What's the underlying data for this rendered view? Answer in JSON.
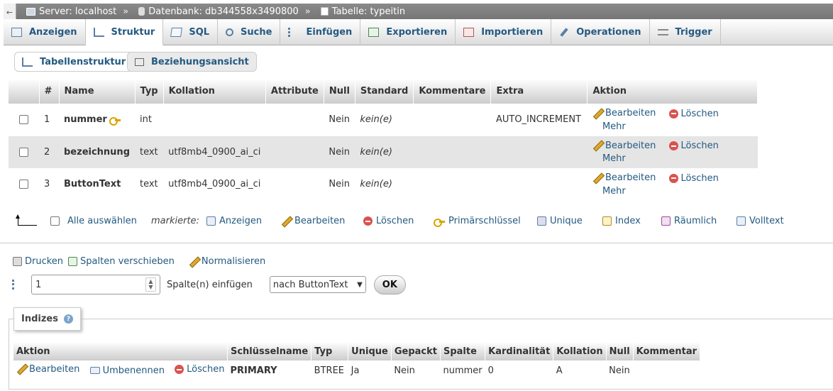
{
  "breadcrumb": {
    "collapse": "←",
    "server": "Server: localhost",
    "database": "Datenbank: db344558x3490800",
    "table": "Tabelle: typeitin",
    "separator": "»"
  },
  "tabs": [
    {
      "label": "Anzeigen",
      "icon": "browse-icon",
      "active": false
    },
    {
      "label": "Struktur",
      "icon": "structure-icon",
      "active": true
    },
    {
      "label": "SQL",
      "icon": "sql-icon",
      "active": false
    },
    {
      "label": "Suche",
      "icon": "search-icon",
      "active": false
    },
    {
      "label": "Einfügen",
      "icon": "insert-icon",
      "active": false
    },
    {
      "label": "Exportieren",
      "icon": "export-icon",
      "active": false
    },
    {
      "label": "Importieren",
      "icon": "import-icon",
      "active": false
    },
    {
      "label": "Operationen",
      "icon": "wrench-icon",
      "active": false
    },
    {
      "label": "Trigger",
      "icon": "trigger-icon",
      "active": false
    }
  ],
  "subtabs": {
    "structure": "Tabellenstruktur",
    "relations": "Beziehungsansicht"
  },
  "columns_table": {
    "headers": [
      "#",
      "Name",
      "Typ",
      "Kollation",
      "Attribute",
      "Null",
      "Standard",
      "Kommentare",
      "Extra",
      "Aktion"
    ],
    "rows": [
      {
        "num": "1",
        "name": "nummer",
        "type": "int",
        "collation": "",
        "attributes": "",
        "null": "Nein",
        "default": "kein(e)",
        "comments": "",
        "extra": "AUTO_INCREMENT",
        "primary": true
      },
      {
        "num": "2",
        "name": "bezeichnung",
        "type": "text",
        "collation": "utf8mb4_0900_ai_ci",
        "attributes": "",
        "null": "Nein",
        "default": "kein(e)",
        "comments": "",
        "extra": "",
        "primary": false
      },
      {
        "num": "3",
        "name": "ButtonText",
        "type": "text",
        "collation": "utf8mb4_0900_ai_ci",
        "attributes": "",
        "null": "Nein",
        "default": "kein(e)",
        "comments": "",
        "extra": "",
        "primary": false
      }
    ],
    "actions": {
      "edit": "Bearbeiten",
      "delete": "Löschen",
      "more": "Mehr"
    }
  },
  "bulk": {
    "select_all": "Alle auswählen",
    "marked": "markierte:",
    "browse": "Anzeigen",
    "edit": "Bearbeiten",
    "delete": "Löschen",
    "primary": "Primärschlüssel",
    "unique": "Unique",
    "index": "Index",
    "spatial": "Räumlich",
    "fulltext": "Volltext"
  },
  "tools": {
    "print": "Drucken",
    "move_columns": "Spalten verschieben",
    "normalize": "Normalisieren"
  },
  "insert": {
    "count": "1",
    "label": "Spalte(n) einfügen",
    "position": "nach ButtonText",
    "ok": "OK"
  },
  "indexes": {
    "title": "Indizes",
    "help": "?",
    "headers": [
      "Aktion",
      "Schlüsselname",
      "Typ",
      "Unique",
      "Gepackt",
      "Spalte",
      "Kardinalität",
      "Kollation",
      "Null",
      "Kommentar"
    ],
    "actions": {
      "edit": "Bearbeiten",
      "rename": "Umbenennen",
      "delete": "Löschen"
    },
    "row": {
      "keyname": "PRIMARY",
      "type": "BTREE",
      "unique": "Ja",
      "packed": "Nein",
      "column": "nummer",
      "cardinality": "0",
      "collation": "A",
      "null": "Nein",
      "comment": ""
    }
  }
}
